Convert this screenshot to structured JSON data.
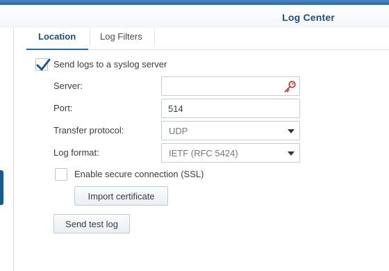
{
  "window": {
    "title": "Log Center"
  },
  "tabs": [
    {
      "label": "Location",
      "active": true
    },
    {
      "label": "Log Filters",
      "active": false
    }
  ],
  "form": {
    "send_syslog": {
      "label": "Send logs to a syslog server",
      "checked": true
    },
    "server": {
      "label": "Server:",
      "value": "",
      "icon": "key-icon"
    },
    "port": {
      "label": "Port:",
      "value": "514"
    },
    "protocol": {
      "label": "Transfer protocol:",
      "value": "UDP"
    },
    "format": {
      "label": "Log format:",
      "value": "IETF (RFC 5424)"
    },
    "ssl": {
      "label": "Enable secure connection (SSL)",
      "checked": false
    }
  },
  "buttons": {
    "import_certificate": "Import certificate",
    "send_test_log": "Send test log"
  },
  "colors": {
    "accent": "#1d4e7e",
    "checkmark": "#1a5a92",
    "key_icon": "#c0392b"
  }
}
